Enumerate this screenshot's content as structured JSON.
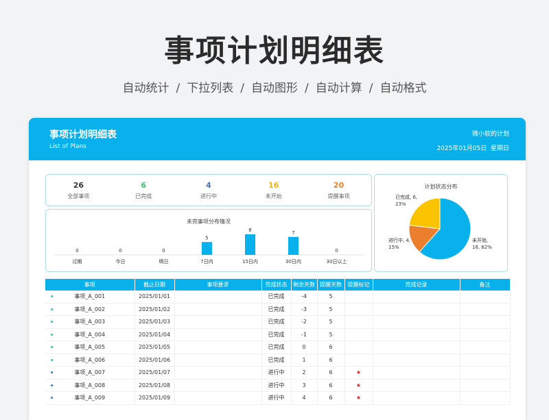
{
  "hero": {
    "title": "事项计划明细表",
    "features": [
      "自动统计",
      "下拉列表",
      "自动图形",
      "自动计算",
      "自动格式"
    ],
    "separator": "/"
  },
  "banner": {
    "title": "事项计划明细表",
    "subtitle": "List of Plans",
    "brand": "微小软的计划",
    "date": "2025年01月05日",
    "weekday": "星期日"
  },
  "kpis": [
    {
      "value": "26",
      "label": "全部事项",
      "color": "#333333"
    },
    {
      "value": "6",
      "label": "已完成",
      "color": "#3cbf6a"
    },
    {
      "value": "4",
      "label": "进行中",
      "color": "#4a6fc0"
    },
    {
      "value": "16",
      "label": "未开始",
      "color": "#f0b400"
    },
    {
      "value": "20",
      "label": "提醒事项",
      "color": "#e8812a"
    }
  ],
  "chart_data": [
    {
      "type": "bar",
      "title": "未完事项分布情况",
      "categories": [
        "过期",
        "今日",
        "明日",
        "7日内",
        "15日内",
        "30日内",
        "30日以上"
      ],
      "values": [
        0,
        0,
        0,
        5,
        8,
        7,
        0
      ],
      "ylim": [
        0,
        8
      ],
      "color": "#08b0ec"
    },
    {
      "type": "pie",
      "title": "计划状态分布",
      "slices": [
        {
          "name": "未开始",
          "value": 16,
          "pct": "62%",
          "color": "#08b0ec"
        },
        {
          "name": "进行中",
          "value": 4,
          "pct": "15%",
          "color": "#ec7f2d"
        },
        {
          "name": "已完成",
          "value": 6,
          "pct": "23%",
          "color": "#fbc400"
        }
      ]
    }
  ],
  "table": {
    "headers": [
      "事项",
      "截止日期",
      "事项要求",
      "完成状态",
      "剩余天数",
      "提醒天数",
      "提醒标记",
      "完成记录",
      "备注"
    ],
    "rows": [
      {
        "dot": "#3cc3a0",
        "name": "事项_A_001",
        "date": "2025/01/01",
        "req": "",
        "status": "已完成",
        "remain": "-4",
        "remind": "5",
        "mark": "",
        "record": "",
        "note": ""
      },
      {
        "dot": "#3cc3a0",
        "name": "事项_A_002",
        "date": "2025/01/02",
        "req": "",
        "status": "已完成",
        "remain": "-3",
        "remind": "5",
        "mark": "",
        "record": "",
        "note": ""
      },
      {
        "dot": "#3cc3a0",
        "name": "事项_A_003",
        "date": "2025/01/03",
        "req": "",
        "status": "已完成",
        "remain": "-2",
        "remind": "5",
        "mark": "",
        "record": "",
        "note": ""
      },
      {
        "dot": "#3cc3a0",
        "name": "事项_A_004",
        "date": "2025/01/04",
        "req": "",
        "status": "已完成",
        "remain": "-1",
        "remind": "5",
        "mark": "",
        "record": "",
        "note": ""
      },
      {
        "dot": "#3cc3a0",
        "name": "事项_A_005",
        "date": "2025/01/05",
        "req": "",
        "status": "已完成",
        "remain": "0",
        "remind": "6",
        "mark": "",
        "record": "",
        "note": ""
      },
      {
        "dot": "#3cc3a0",
        "name": "事项_A_006",
        "date": "2025/01/06",
        "req": "",
        "status": "已完成",
        "remain": "1",
        "remind": "6",
        "mark": "",
        "record": "",
        "note": ""
      },
      {
        "dot": "#3a78c8",
        "name": "事项_A_007",
        "date": "2025/01/07",
        "req": "",
        "status": "进行中",
        "remain": "2",
        "remind": "6",
        "mark": "★",
        "record": "",
        "note": ""
      },
      {
        "dot": "#3a78c8",
        "name": "事项_A_008",
        "date": "2025/01/08",
        "req": "",
        "status": "进行中",
        "remain": "3",
        "remind": "6",
        "mark": "★",
        "record": "",
        "note": ""
      },
      {
        "dot": "#3a78c8",
        "name": "事项_A_009",
        "date": "2025/01/09",
        "req": "",
        "status": "进行中",
        "remain": "4",
        "remind": "6",
        "mark": "★",
        "record": "",
        "note": ""
      }
    ]
  }
}
